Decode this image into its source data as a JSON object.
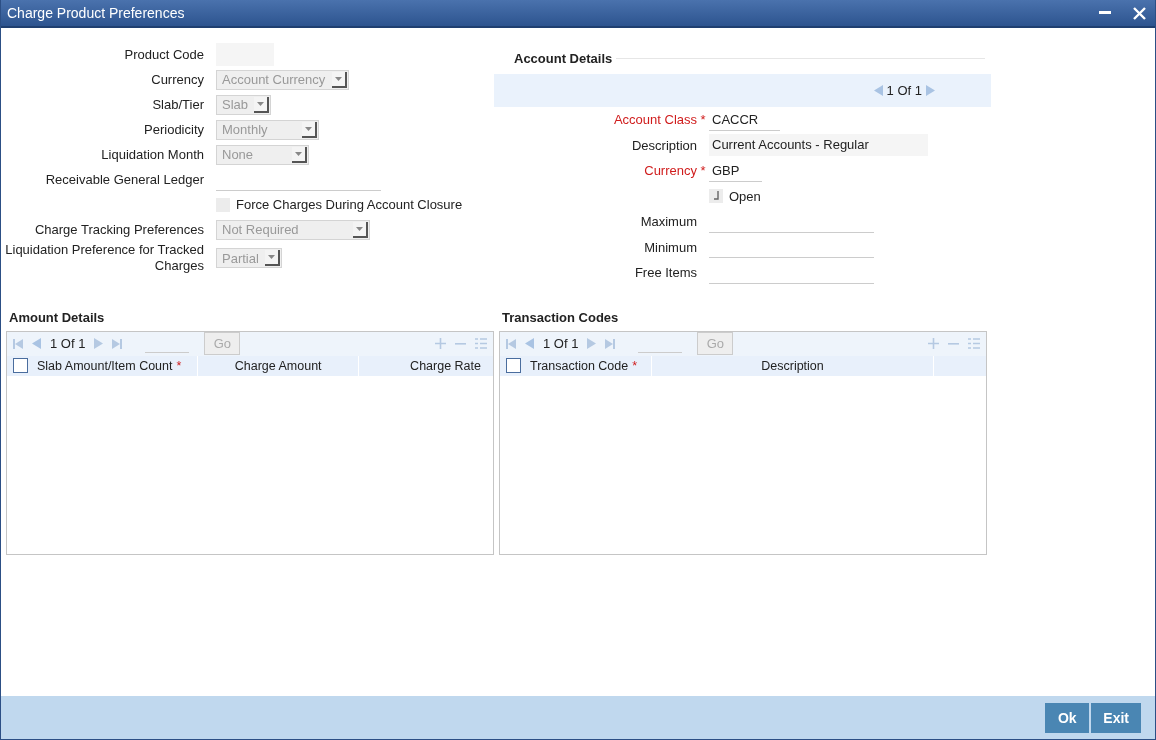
{
  "window": {
    "title": "Charge Product Preferences"
  },
  "preferences": [
    {
      "kind": "text",
      "label": "Product Code"
    },
    {
      "kind": "select",
      "label": "Currency",
      "value": "Account Currency"
    },
    {
      "kind": "select",
      "label": "Slab/Tier",
      "value": "Slab"
    },
    {
      "kind": "select",
      "label": "Periodicity",
      "value": "Monthly"
    },
    {
      "kind": "select",
      "label": "Liquidation Month",
      "value": "None"
    },
    {
      "kind": "line",
      "label": "Receivable General Ledger"
    },
    {
      "kind": "checkbox",
      "label": "Force Charges During Account Closure",
      "checked": false
    },
    {
      "kind": "select",
      "label": "Charge Tracking Preferences",
      "value": "Not Required"
    },
    {
      "kind": "select",
      "label": "Liquidation Preference for Tracked Charges",
      "value": "Partial"
    }
  ],
  "account_details": {
    "title": "Account Details",
    "pager": "1 Of 1",
    "fields": [
      {
        "kind": "line",
        "label": "Account Class",
        "mark": "*",
        "value": "CACCR"
      },
      {
        "kind": "text",
        "label": "Description",
        "value": "Current Accounts - Regular"
      },
      {
        "kind": "line",
        "label": "Currency",
        "mark": "*",
        "value": "GBP"
      },
      {
        "kind": "checkbox",
        "label": "Open",
        "checked": true
      },
      {
        "kind": "line",
        "label": "Maximum"
      },
      {
        "kind": "line",
        "label": "Minimum"
      },
      {
        "kind": "line",
        "label": "Free Items"
      }
    ]
  },
  "grids": [
    {
      "title": "Amount Details",
      "pager": "1 Of 1",
      "go": "Go",
      "select_all_checked": false,
      "columns": [
        {
          "label": "Slab Amount/Item Count",
          "mark": "*"
        },
        {
          "label": "Charge Amount"
        },
        {
          "label": "Charge Rate"
        }
      ]
    },
    {
      "title": "Transaction Codes",
      "pager": "1 Of 1",
      "go": "Go",
      "select_all_checked": false,
      "columns": [
        {
          "label": "Transaction Code",
          "mark": "*"
        },
        {
          "label": "Description"
        }
      ]
    }
  ],
  "buttons": [
    "Ok",
    "Exit"
  ]
}
